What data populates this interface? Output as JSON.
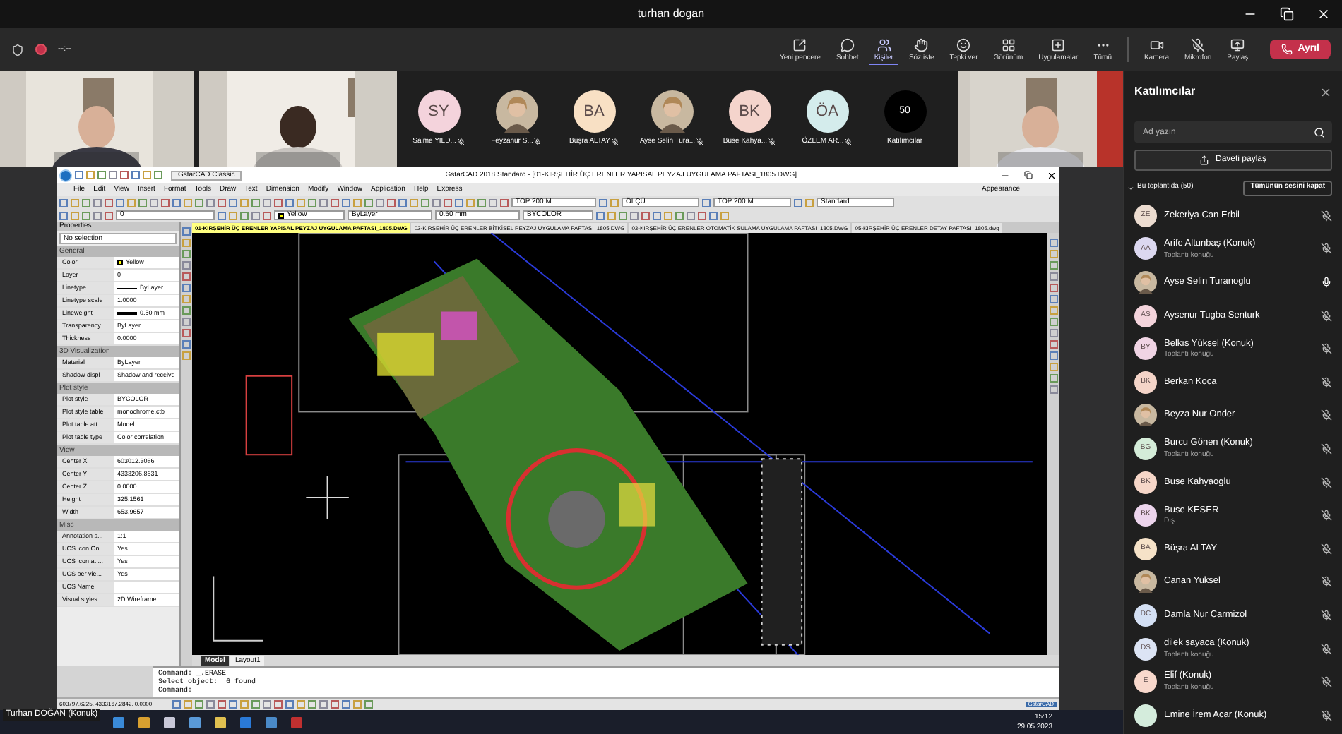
{
  "window": {
    "title": "turhan dogan"
  },
  "meeting_bar": {
    "timer": "--:--",
    "leave_button": "Ayrıl",
    "actions": [
      {
        "label": "Yeni pencere",
        "selected": false
      },
      {
        "label": "Sohbet",
        "selected": false
      },
      {
        "label": "Kişiler",
        "selected": true
      },
      {
        "label": "Söz iste",
        "selected": false
      },
      {
        "label": "Tepki ver",
        "selected": false
      },
      {
        "label": "Görünüm",
        "selected": false
      },
      {
        "label": "Uygulamalar",
        "selected": false
      },
      {
        "label": "Tümü",
        "selected": false
      },
      {
        "label": "Kamera",
        "selected": false
      },
      {
        "label": "Mikrofon",
        "selected": false
      },
      {
        "label": "Paylaş",
        "selected": false
      }
    ]
  },
  "gallery": [
    {
      "kind": "video"
    },
    {
      "kind": "video"
    },
    {
      "kind": "initials",
      "initials": "SY",
      "name": "Saime YILD...",
      "muted": true,
      "color": "#f4d3dc"
    },
    {
      "name": "Feyzanur S...",
      "muted": true
    },
    {
      "kind": "initials",
      "initials": "BA",
      "name": "Büşra ALTAY",
      "muted": true,
      "color": "#f8e0c4"
    },
    {
      "name": "Ayse Selin Tura...",
      "muted": true
    },
    {
      "kind": "initials",
      "initials": "BK",
      "name": "Buse Kahya...",
      "muted": true,
      "color": "#f4d4cc"
    },
    {
      "kind": "initials",
      "initials": "ÖA",
      "name": "ÖZLEM AR...",
      "muted": true,
      "color": "#d4ecec"
    },
    {
      "kind": "count",
      "initials": "50",
      "name": "Katılımcılar"
    },
    {
      "kind": "video"
    }
  ],
  "shared_screen": {
    "presenter": "Turhan DOĞAN (Konuk)",
    "cad": {
      "title": "GstarCAD 2018 Standard - [01-KIRŞEHİR ÜÇ ERENLER YAPISAL PEYZAJ UYGULAMA PAFTASI_1805.DWG]",
      "workspace": "GstarCAD Classic",
      "menu": [
        "File",
        "Edit",
        "View",
        "Insert",
        "Format",
        "Tools",
        "Draw",
        "Text",
        "Dimension",
        "Modify",
        "Window",
        "Application",
        "Help",
        "Express"
      ],
      "appearance": "Appearance",
      "style_fields": [
        "TOP 200 M",
        "ÖLÇÜ",
        "TOP 200 M",
        "Standard"
      ],
      "layer_fields": [
        "0",
        "Yellow",
        "ByLayer",
        "0.50 mm",
        "BYCOLOR"
      ],
      "file_tabs": [
        {
          "label": "01-KIRŞEHİR ÜÇ ERENLER YAPISAL PEYZAJ UYGULAMA PAFTASI_1805.DWG",
          "selected": true
        },
        {
          "label": "02-KIRŞEHİR ÜÇ ERENLER BİTKİSEL PEYZAJ UYGULAMA PAFTASI_1805.DWG",
          "selected": false
        },
        {
          "label": "03-KIRŞEHİR ÜÇ ERENLER OTOMATİK SULAMA UYGULAMA PAFTASI_1805.DWG",
          "selected": false
        },
        {
          "label": "05-KIRŞEHİR ÜÇ ERENLER DETAY PAFTASI_1805.dwg",
          "selected": false
        }
      ],
      "properties": {
        "title": "Properties",
        "selection": "No selection",
        "sections": [
          {
            "title": "General",
            "rows": [
              {
                "kind": "color",
                "label": "Color",
                "value": "Yellow"
              },
              {
                "kind": "text",
                "label": "Layer",
                "value": "0"
              },
              {
                "kind": "line",
                "label": "Linetype",
                "value": "ByLayer"
              },
              {
                "kind": "text",
                "label": "Linetype scale",
                "value": "1.0000"
              },
              {
                "kind": "weight",
                "label": "Lineweight",
                "value": "0.50 mm"
              },
              {
                "kind": "text",
                "label": "Transparency",
                "value": "ByLayer"
              },
              {
                "kind": "text",
                "label": "Thickness",
                "value": "0.0000"
              }
            ]
          },
          {
            "title": "3D Visualization",
            "rows": [
              {
                "kind": "text",
                "label": "Material",
                "value": "ByLayer"
              },
              {
                "kind": "text",
                "label": "Shadow displ",
                "value": "Shadow and receive"
              }
            ]
          },
          {
            "title": "Plot style",
            "rows": [
              {
                "kind": "text",
                "label": "Plot style",
                "value": "BYCOLOR"
              },
              {
                "kind": "text",
                "label": "Plot style table",
                "value": "monochrome.ctb"
              },
              {
                "kind": "text",
                "label": "Plot table att...",
                "value": "Model"
              },
              {
                "kind": "text",
                "label": "Plot table type",
                "value": "Color correlation"
              }
            ]
          },
          {
            "title": "View",
            "rows": [
              {
                "kind": "text",
                "label": "Center X",
                "value": "603012.3086"
              },
              {
                "kind": "text",
                "label": "Center Y",
                "value": "4333206.8631"
              },
              {
                "kind": "text",
                "label": "Center Z",
                "value": "0.0000"
              },
              {
                "kind": "text",
                "label": "Height",
                "value": "325.1561"
              },
              {
                "kind": "text",
                "label": "Width",
                "value": "653.9657"
              }
            ]
          },
          {
            "title": "Misc",
            "rows": [
              {
                "kind": "text",
                "label": "Annotation s...",
                "value": "1:1"
              },
              {
                "kind": "text",
                "label": "UCS icon On",
                "value": "Yes"
              },
              {
                "kind": "text",
                "label": "UCS icon at ...",
                "value": "Yes"
              },
              {
                "kind": "text",
                "label": "UCS per vie...",
                "value": "Yes"
              },
              {
                "kind": "text",
                "label": "UCS Name"
              },
              {
                "kind": "text",
                "label": "Visual styles",
                "value": "2D Wireframe"
              }
            ]
          }
        ]
      },
      "layout_tabs": [
        {
          "label": "Model",
          "selected": true
        },
        {
          "label": "Layout1",
          "selected": false
        }
      ],
      "command_lines": [
        "Command: _.ERASE",
        "Select object:  6 found",
        "Command:"
      ],
      "coordinates": "603797.6225, 4333167.2842, 0.0000",
      "status_app": "GstarCAD"
    },
    "taskbar": {
      "time": "15:12",
      "date": "29.05.2023"
    }
  },
  "participants_panel": {
    "title": "Katılımcılar",
    "search": {
      "placeholder": "Ad yazın"
    },
    "invite_button": "Daveti paylaş",
    "section": {
      "label": "Bu toplantıda (50)",
      "expanded": true
    },
    "mute_all_button": "Tümünün sesini kapat",
    "participants": [
      {
        "kind": "initials",
        "initials": "ZE",
        "name": "Zekeriya Can Erbil",
        "muted": true,
        "color": "#ecdcd0"
      },
      {
        "kind": "initials",
        "initials": "AA",
        "name": "Arife Altunbaş (Konuk)",
        "sub": "Toplantı konuğu",
        "muted": true,
        "color": "#dcd8f0"
      },
      {
        "name": "Ayse Selin Turanoglu",
        "muted": false
      },
      {
        "kind": "initials",
        "initials": "AS",
        "name": "Aysenur Tugba Senturk",
        "muted": true,
        "color": "#f4d4dc"
      },
      {
        "kind": "initials",
        "initials": "BY",
        "name": "Belkıs Yüksel (Konuk)",
        "sub": "Toplantı konuğu",
        "muted": true,
        "color": "#f0d4e4"
      },
      {
        "kind": "initials",
        "initials": "BK",
        "name": "Berkan Koca",
        "muted": true,
        "color": "#f4d4c8"
      },
      {
        "name": "Beyza Nur Onder",
        "muted": true
      },
      {
        "kind": "initials",
        "initials": "BG",
        "name": "Burcu Gönen (Konuk)",
        "sub": "Toplantı konuğu",
        "muted": true,
        "color": "#d4ecd8"
      },
      {
        "kind": "initials",
        "initials": "BK",
        "name": "Buse Kahyaoglu",
        "muted": true,
        "color": "#f6d6c8"
      },
      {
        "kind": "initials",
        "initials": "BK",
        "name": "Buse KESER",
        "sub": "Dış",
        "muted": true,
        "color": "#ecd4ec"
      },
      {
        "kind": "initials",
        "initials": "BA",
        "name": "Büşra ALTAY",
        "muted": true,
        "color": "#f6e2c8"
      },
      {
        "name": "Canan Yuksel",
        "muted": true
      },
      {
        "kind": "initials",
        "initials": "DC",
        "name": "Damla Nur Carmizol",
        "muted": true,
        "color": "#d4e0f4"
      },
      {
        "kind": "initials",
        "initials": "DS",
        "name": "dilek sayaca (Konuk)",
        "sub": "Toplantı konuğu",
        "muted": true,
        "color": "#dce4f4"
      },
      {
        "kind": "initials",
        "initials": "E",
        "name": "Elif (Konuk)",
        "sub": "Toplantı konuğu",
        "muted": true,
        "color": "#f8d8cc"
      },
      {
        "kind": "initials",
        "name": "Emine İrem Acar (Konuk)",
        "muted": true,
        "color": "#d4ecdc"
      }
    ]
  }
}
